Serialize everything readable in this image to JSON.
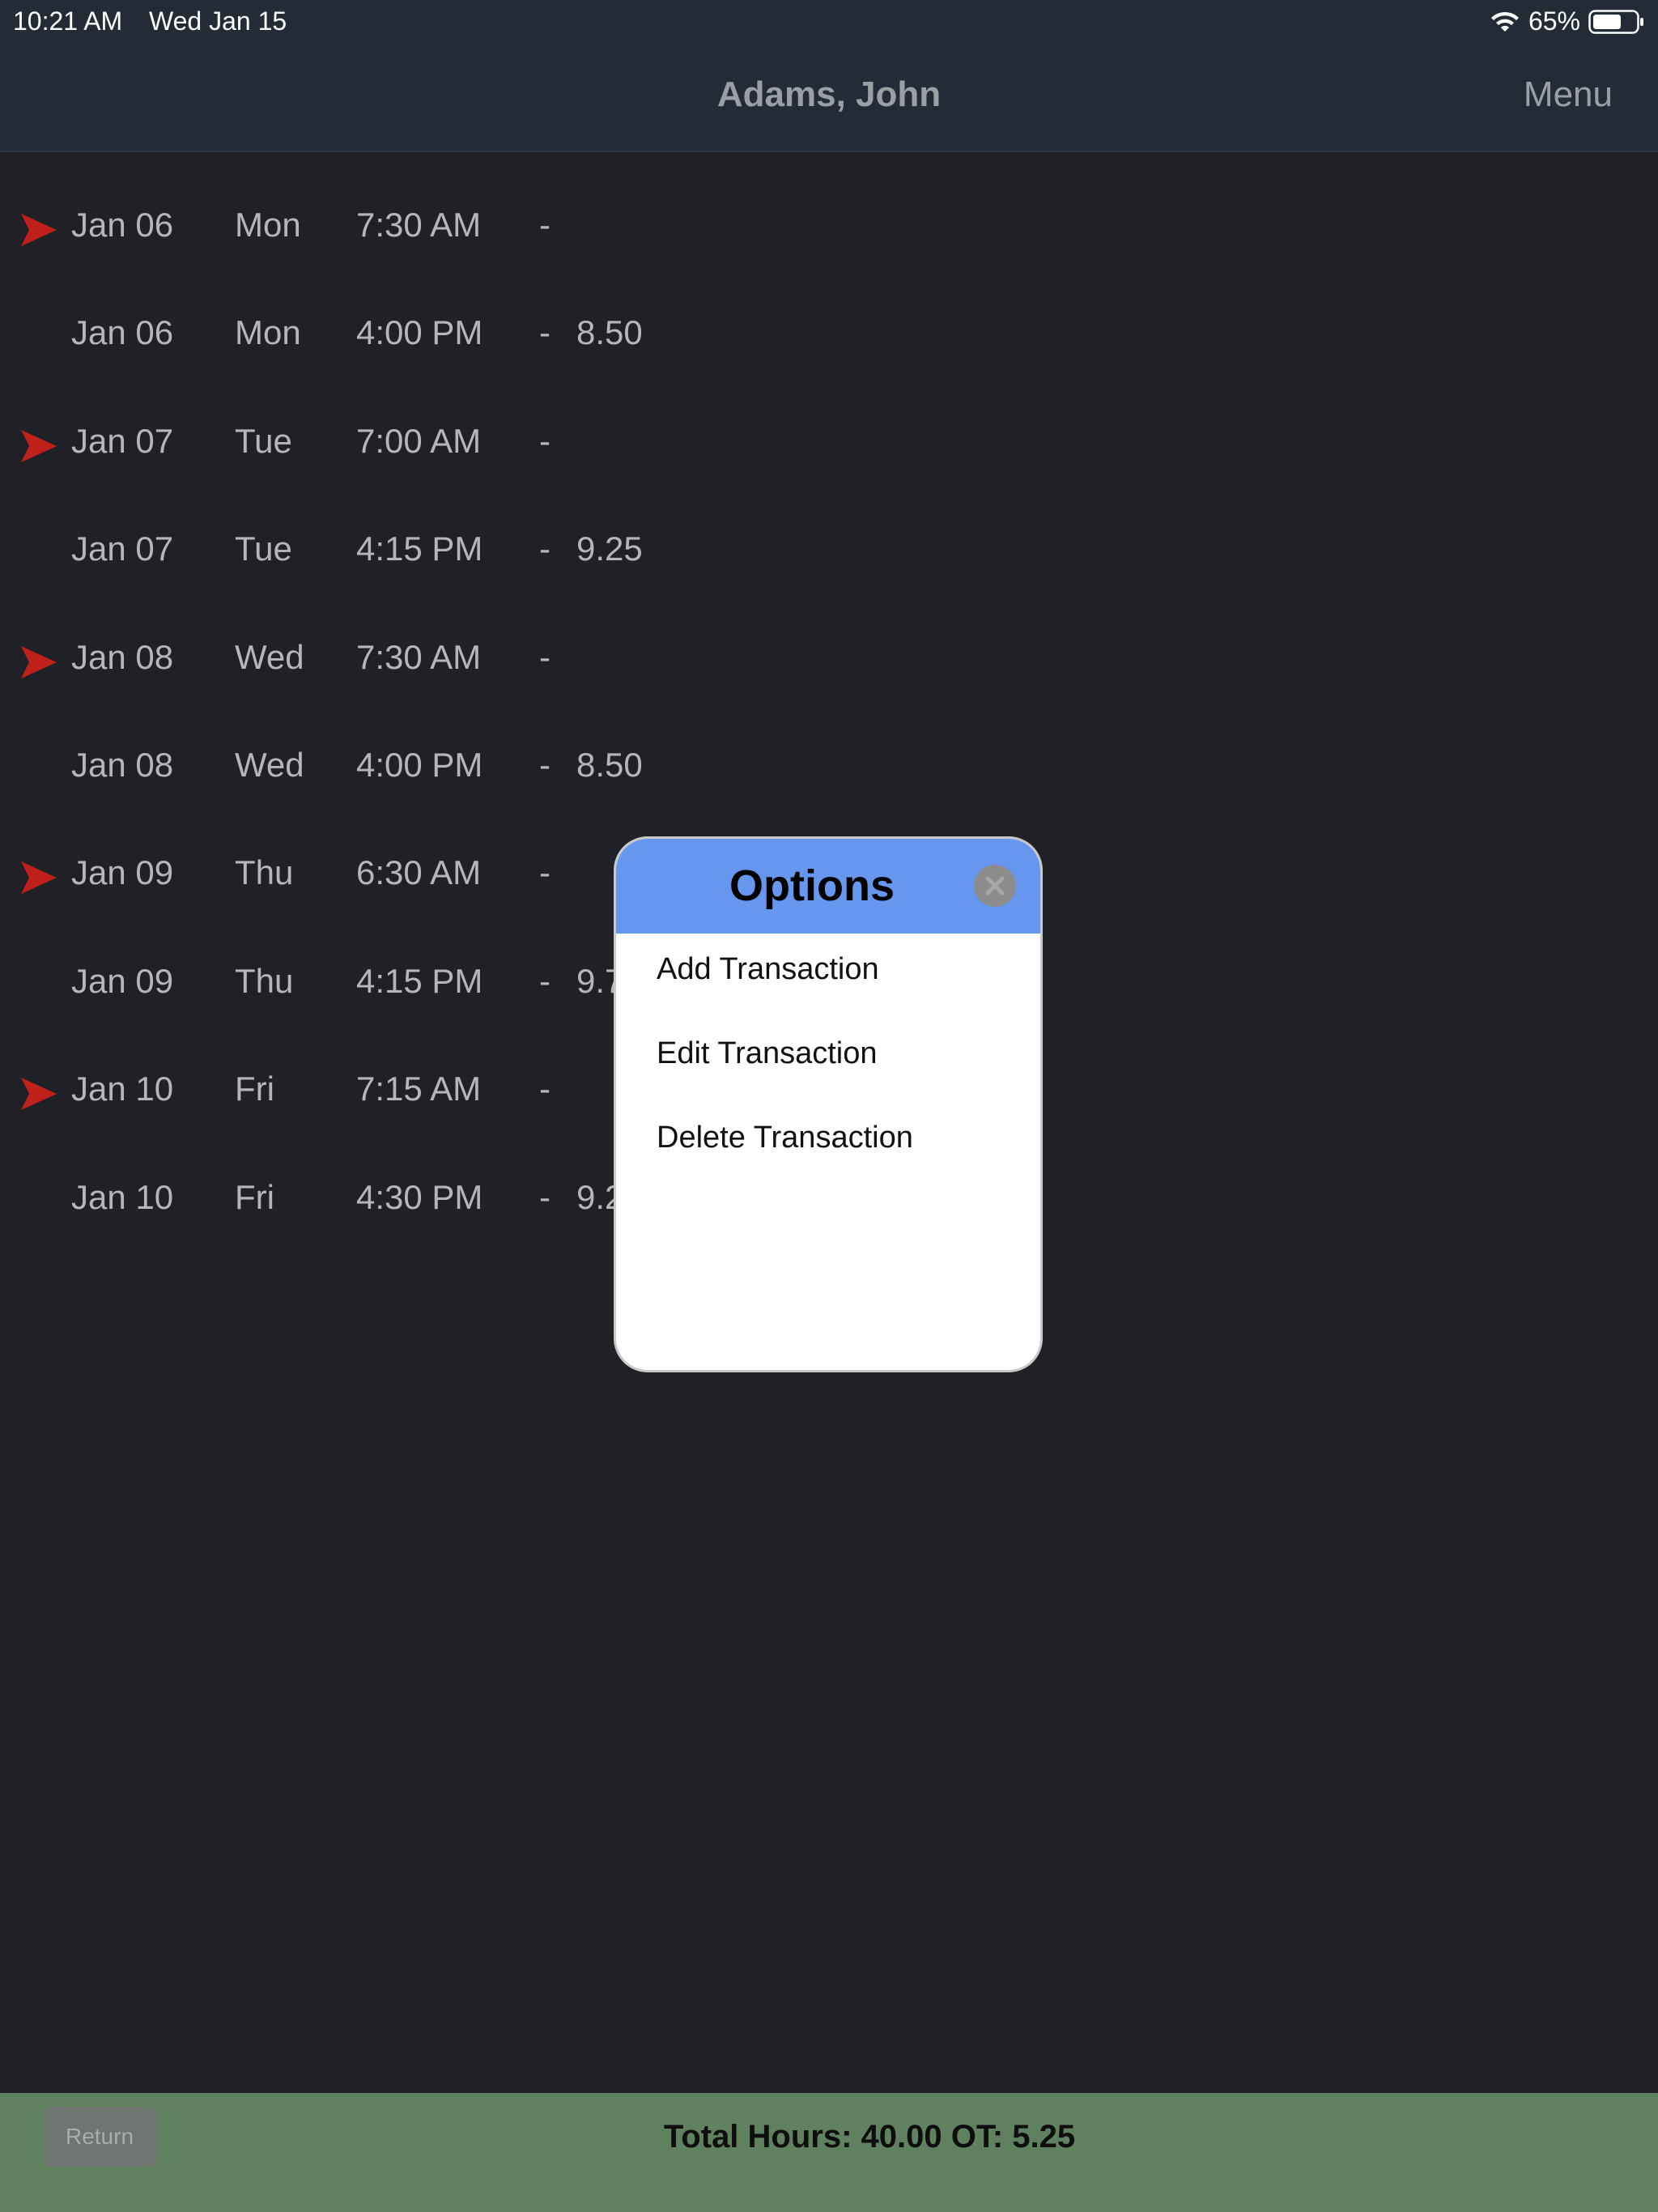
{
  "status_bar": {
    "time": "10:21 AM",
    "date": "Wed Jan 15",
    "battery": "65%",
    "icons": [
      "wifi-icon",
      "battery-icon"
    ]
  },
  "header": {
    "title": "Adams, John",
    "menu_label": "Menu"
  },
  "rows": [
    {
      "date": "Jan 06",
      "day": "Mon",
      "time": "7:30 AM",
      "dash": "-",
      "hours": "",
      "marker": true
    },
    {
      "date": "Jan 06",
      "day": "Mon",
      "time": "4:00 PM",
      "dash": "-",
      "hours": "8.50",
      "marker": false
    },
    {
      "date": "Jan 07",
      "day": "Tue",
      "time": "7:00 AM",
      "dash": "-",
      "hours": "",
      "marker": true
    },
    {
      "date": "Jan 07",
      "day": "Tue",
      "time": "4:15 PM",
      "dash": "-",
      "hours": "9.25",
      "marker": false
    },
    {
      "date": "Jan 08",
      "day": "Wed",
      "time": "7:30 AM",
      "dash": "-",
      "hours": "",
      "marker": true
    },
    {
      "date": "Jan 08",
      "day": "Wed",
      "time": "4:00 PM",
      "dash": "-",
      "hours": "8.50",
      "marker": false
    },
    {
      "date": "Jan 09",
      "day": "Thu",
      "time": "6:30 AM",
      "dash": "-",
      "hours": "",
      "marker": true
    },
    {
      "date": "Jan 09",
      "day": "Thu",
      "time": "4:15 PM",
      "dash": "-",
      "hours": "9.7",
      "marker": false
    },
    {
      "date": "Jan 10",
      "day": "Fri",
      "time": "7:15 AM",
      "dash": "-",
      "hours": "",
      "marker": true
    },
    {
      "date": "Jan 10",
      "day": "Fri",
      "time": "4:30 PM",
      "dash": "-",
      "hours": "9.2",
      "marker": false
    }
  ],
  "popup": {
    "title": "Options",
    "items": [
      "Add Transaction",
      "Edit Transaction",
      "Delete Transaction"
    ],
    "close_icon": "close-icon"
  },
  "footer": {
    "return_label": "Return",
    "total_text": "Total  Hours: 40.00  OT: 5.25"
  },
  "colors": {
    "background": "#1f2126",
    "header": "#222b36",
    "popup_header": "#6696ee",
    "footer": "#5f8160",
    "marker": "#c0201a"
  }
}
